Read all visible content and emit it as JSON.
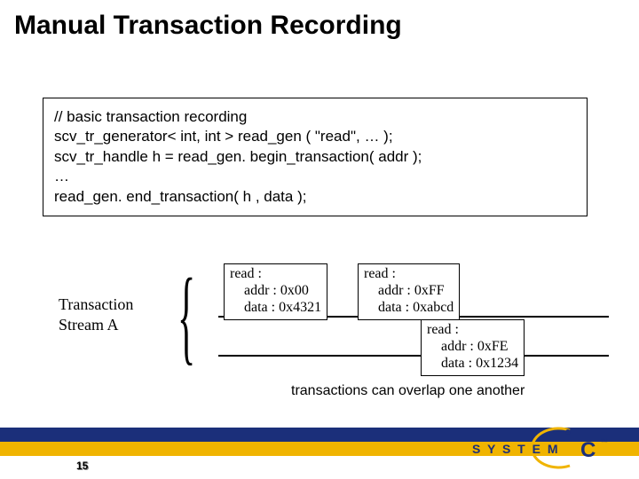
{
  "title": "Manual Transaction Recording",
  "code": {
    "l1": "// basic transaction recording",
    "l2": "scv_tr_generator< int, int > read_gen ( \"read\", … );",
    "l3": "scv_tr_handle h = read_gen. begin_transaction( addr );",
    "l4": "…",
    "l5": "read_gen. end_transaction( h , data );"
  },
  "stream_label": {
    "l1": "Transaction",
    "l2": "Stream A"
  },
  "txns": [
    {
      "hdr": "read :",
      "addr": "addr : 0x00",
      "data": "data : 0x4321"
    },
    {
      "hdr": "read :",
      "addr": "addr : 0xFF",
      "data": "data : 0xabcd"
    },
    {
      "hdr": "read :",
      "addr": "addr : 0xFE",
      "data": "data : 0x1234"
    }
  ],
  "caption": "transactions can overlap one another",
  "page_number": "15",
  "logo_text": {
    "brand": "S Y S T E M",
    "c": "C",
    "tm": "™"
  }
}
